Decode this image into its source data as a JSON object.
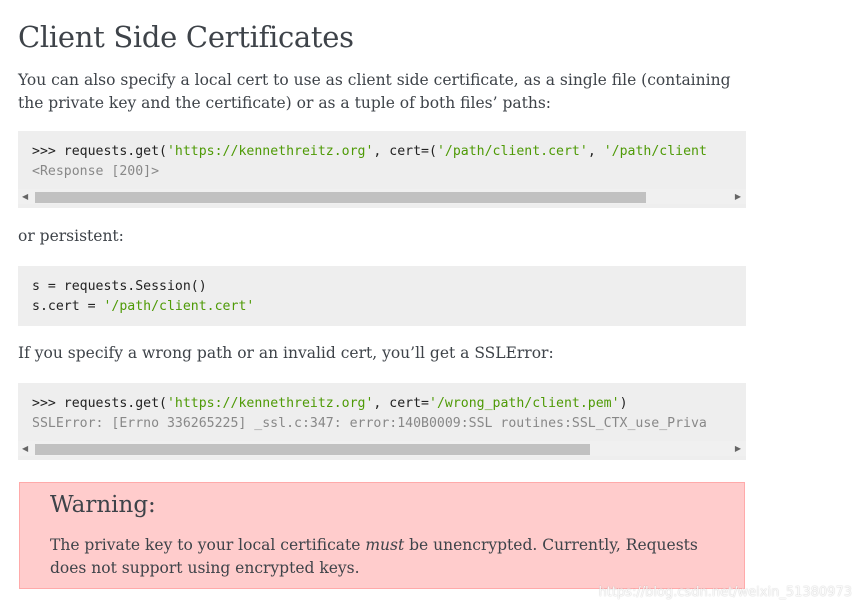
{
  "section": {
    "title": "Client Side Certificates",
    "intro": "You can also specify a local cert to use as client side certificate, as a single file (containing the private key and the certificate) or as a tuple of both files’ paths:",
    "code1": {
      "line1_prompt": ">>> requests.get(",
      "line1_url": "'https://kennethreitz.org'",
      "line1_mid": ", cert=(",
      "line1_cert": "'/path/client.cert'",
      "line1_sep": ", ",
      "line1_key": "'/path/client",
      "line2_output": "<Response [200]>",
      "scroll_fraction": 0.88
    },
    "persistent_label": "or persistent:",
    "code2": {
      "line1": "s = requests.Session()",
      "line2_prefix": "s.cert = ",
      "line2_value": "'/path/client.cert'"
    },
    "error_intro": "If you specify a wrong path or an invalid cert, you’ll get a SSLError:",
    "code3": {
      "line1_prompt": ">>> requests.get(",
      "line1_url": "'https://kennethreitz.org'",
      "line1_mid": ", cert=",
      "line1_cert": "'/wrong_path/client.pem'",
      "line1_end": ")",
      "line2_output": "SSLError: [Errno 336265225] _ssl.c:347: error:140B0009:SSL routines:SSL_CTX_use_Priva",
      "scroll_fraction": 0.8
    }
  },
  "warning": {
    "title": "Warning:",
    "text_before": "The private key to your local certificate ",
    "text_emphasis": "must",
    "text_after": " be unencrypted. Currently, Requests does not support using encrypted keys."
  },
  "watermark": "https://blog.csdn.net/weixin_51380973",
  "colors": {
    "code_background": "#eeeeee",
    "string": "#4e9a06",
    "output": "#888888",
    "warning_background": "#ffcccc",
    "warning_border": "#ffaaaa"
  }
}
